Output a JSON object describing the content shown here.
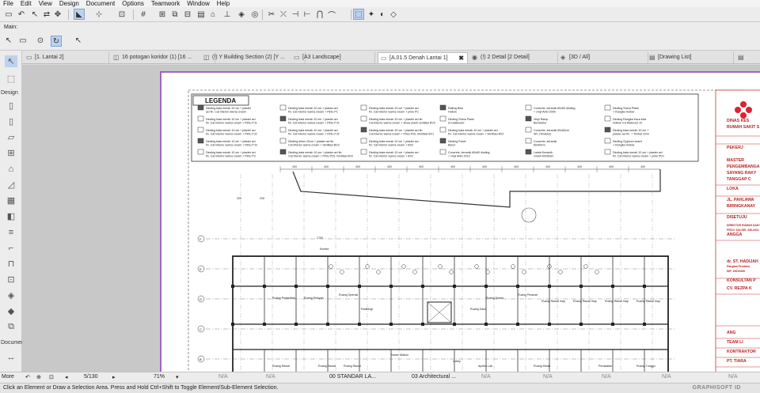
{
  "menu": [
    "File",
    "Edit",
    "View",
    "Design",
    "Document",
    "Options",
    "Teamwork",
    "Window",
    "Help"
  ],
  "main_label": "Main:",
  "toolbox": {
    "design": "Design",
    "document": "Documen",
    "more": "More"
  },
  "tabs": [
    {
      "label": "[1. Lantai 2]"
    },
    {
      "label": "16 potogan koridor (1) [16 ..."
    },
    {
      "label": "(!) Y Building Section (2) [Y ..."
    },
    {
      "label": "[A3 Landscape]"
    },
    {
      "label": "[A.01.5 Denah Lantai 1]",
      "close": "✖"
    },
    {
      "label": "(!) 2 Detail [2 Detail]"
    },
    {
      "label": "[3D / All]"
    },
    {
      "label": "[Drawing List]"
    }
  ],
  "status": {
    "page": "5/130",
    "zoom": "71%",
    "na": "N/A",
    "layer_combo": "00 STANDAR LA...",
    "arch": "03 Architectural ..."
  },
  "hint": "Click an Element or Draw a Selection Area. Press and Hold Ctrl+Shift to Toggle Element/Sub-Element Selection.",
  "brand": "GRAPHISOFT ID",
  "legend": {
    "title": "LEGENDA",
    "items": [
      "Dinding bata merah 10 cm + plaster aci fin. Cat interior warna cream",
      "Dinding bata merah 10 cm + plaster aci fin. Cat interior warna cream + Pintu PJ1",
      "Dinding bata merah 10 cm + plaster aci fin. Cat interior warna cream + Pintu PJ2",
      "Dinding bata merah 10 cm + plaster aci fin. Cat interior warna cream + Pintu PJ3",
      "Dinding bata merah 10 cm + plaster aci fin. Cat interior warna cream + Pintu P2",
      "Dinding bata merah 10 cm + plaster aci fin. Cat interior warna cream + Pintu P1",
      "Dinding bata merah 10 cm + plaster aci fin. Cat interior warna cream + Pintu PJ1",
      "Dinding bata merah 10 cm + plaster aci fin. Cat interior warna cream + Pintu PJ2",
      "Dinding beton 20cm + plaster aci fin. Cat interior warna cream + Ventilasi BV3",
      "Dinding bata merah 10 cm + plaster aci fin. Cat interior warna cream + Pintu P2/L Ventilasi BV2",
      "Dinding bata merah 10 cm + plaster aci fin. Cat interior warna cream + pintu PC",
      "Dinding bata merah 10 cm + plaster aci fin. Cat interior warna cream + shear plank ventilasi BV2",
      "Dinding bata merah 10 cm + plaster aci fin. Cat interior warna cream + Pintu P2/L Ventilasi BV1",
      "Dinding bata merah 10 cm + plaster aci fin. Cat interior warna cream + BV2",
      "Dinding bata merah 10 cm + plaster aci fin. Cat interior warna cream + BV2",
      "Railing Besi Hollow",
      "Dinding Shera Plank & Kalsiboard",
      "Dinding bata merah 10 cm + plaster aci fin. Cat interior warna cream + Ventilasi BV2",
      "Dinding Panel Beton",
      "Concrete, keramik 60x60 dinding + vinyl AHD 2013",
      "Concrete, keramik 60x60 dinding + vinyl AHD 2005",
      "Vinyl Ramp Bertekstur",
      "Concrete, keramik 60x60cm WC (Teraktur)",
      "Concrete, keramik 60x60cm",
      "Lantai Keramik Granit 60x60cm",
      "Dinding Shera Plank + Rangka Hollow",
      "Dinding Rangka Kaca besi Hollow 4.6 Waterset 10",
      "Dinding bata merah 10 cm + plaster aci fin. + Timbal 2mm",
      "Dinding Gypsum board + Rangka Hollow",
      "Dinding bata merah 10 cm + plaster aci fin. Cat interior warna cream + pintu PD1"
    ]
  },
  "titleblock": [
    "DINAS KES",
    "RUMAH SAKIT S",
    "PEKERJ",
    "MASTER",
    "PENGEMBANGA",
    "SAYANG RAKY",
    "TANGGAP C",
    "LOKA",
    "JL. PAHLAWA",
    "BIRINGKANAY",
    "DISETUJU",
    "DIREKTUR RUMAH SAKIT",
    "PROV. SULSEL SELAKU",
    "ANGGA",
    "dr. ST. HADIJAH",
    "Pangkat Pembina",
    "NIP. 19610406",
    "KONSULTAN P",
    "CV. REZPA K",
    "ANG",
    "TEAM LI",
    "KONTRAKTOR",
    "PT. TIARA"
  ],
  "plan": {
    "rooms": [
      "Koridor",
      "Ruang Perawatan",
      "Ruang Pelayan",
      "Ruang Operasi",
      "Radiologi",
      "Ruang Ganti",
      "Ruang Dokter",
      "Ruang Perawat",
      "Ruang Rawat Inap",
      "Ruang Rawat Inap",
      "Ruang Rawat Inap",
      "Ruang Rawat Inap",
      "Lobby",
      "Apotek Lab",
      "Nurse Station",
      "Ruang Rawat",
      "Ruang Rawat",
      "Ruang Rawat",
      "Perawatan",
      "Ruang Medis",
      "Ruang Pengawas",
      "Ruang Tunggu"
    ],
    "dims": [
      "400",
      "400",
      "400",
      "400",
      "400",
      "400",
      "400",
      "400",
      "400",
      "400",
      "400",
      "400",
      "300",
      "208",
      "1750"
    ],
    "grid": [
      "F",
      "E",
      "D",
      "C",
      "B",
      "A"
    ]
  }
}
